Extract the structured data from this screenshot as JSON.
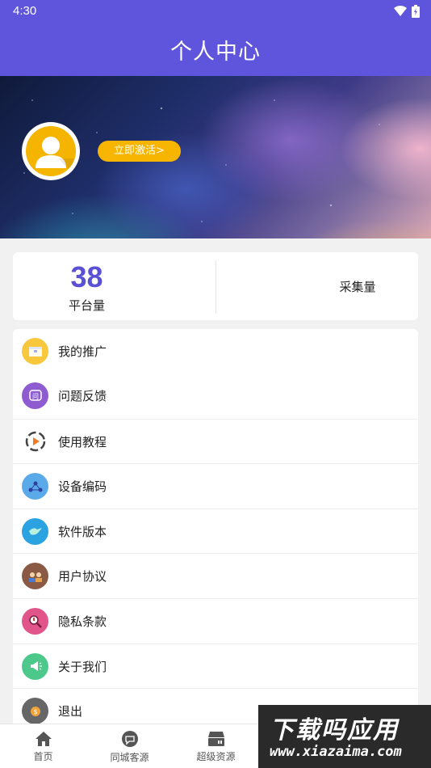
{
  "status": {
    "time": "4:30"
  },
  "header": {
    "title": "个人中心"
  },
  "profile": {
    "activate_label": "立即激活>"
  },
  "stats": {
    "platform_count": "38",
    "platform_label": "平台量",
    "collect_label": "采集量"
  },
  "menu": {
    "items": [
      {
        "label": "我的推广",
        "icon": "box-icon",
        "color": "#f9c73c"
      },
      {
        "label": "问题反馈",
        "icon": "question-icon",
        "color": "#8e5cd0"
      },
      {
        "label": "使用教程",
        "icon": "play-icon",
        "color": "#ffffff"
      },
      {
        "label": "设备编码",
        "icon": "network-icon",
        "color": "#5aa9e8"
      },
      {
        "label": "软件版本",
        "icon": "bird-icon",
        "color": "#2aa3e0"
      },
      {
        "label": "用户协议",
        "icon": "people-icon",
        "color": "#8a5a44"
      },
      {
        "label": "隐私条款",
        "icon": "magnifier-icon",
        "color": "#e2558a"
      },
      {
        "label": "关于我们",
        "icon": "megaphone-icon",
        "color": "#4cc98a"
      },
      {
        "label": "退出",
        "icon": "exit-icon",
        "color": "#666666"
      }
    ]
  },
  "tabbar": {
    "items": [
      {
        "label": "首页",
        "icon": "home-icon"
      },
      {
        "label": "同城客源",
        "icon": "chat-icon"
      },
      {
        "label": "超级资源",
        "icon": "server-icon"
      }
    ]
  },
  "watermark": {
    "line1": "下载吗应用",
    "line2": "www.xiazaima.com"
  },
  "colors": {
    "primary": "#5f55dd",
    "accent": "#f7b500"
  }
}
